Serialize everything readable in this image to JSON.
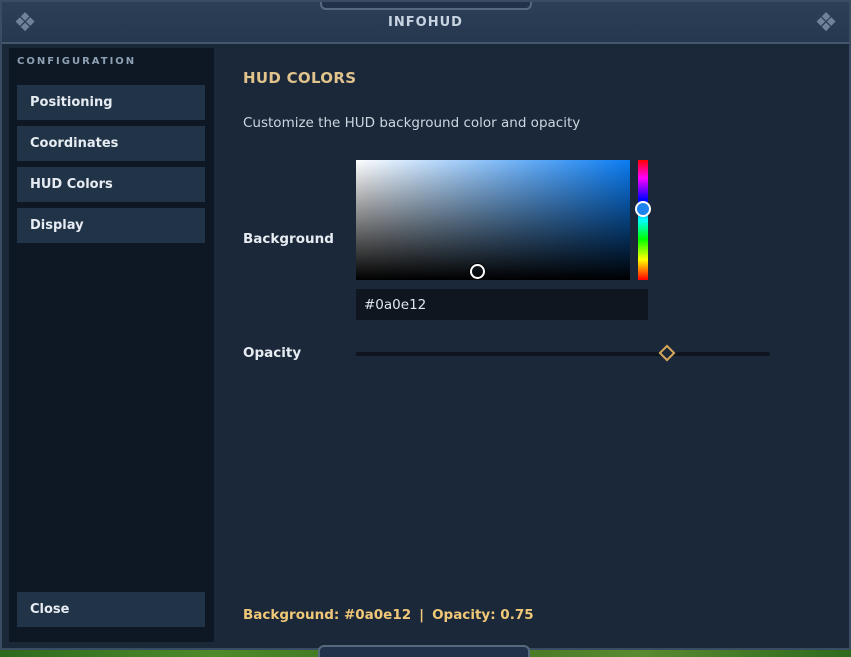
{
  "window": {
    "title": "INFOHUD"
  },
  "sidebar": {
    "section_label": "CONFIGURATION",
    "items": [
      {
        "label": "Positioning"
      },
      {
        "label": "Coordinates"
      },
      {
        "label": "HUD Colors"
      },
      {
        "label": "Display"
      }
    ],
    "close_label": "Close"
  },
  "main": {
    "title": "HUD COLORS",
    "description": "Customize the HUD background color and opacity",
    "background": {
      "label": "Background",
      "hex_value": "#0a0e12",
      "picker_hue_color": "#1c82ee"
    },
    "opacity": {
      "label": "Opacity",
      "value": 0.75
    },
    "status": {
      "background_text": "Background: #0a0e12",
      "separator": "|",
      "opacity_text": "Opacity: 0.75"
    }
  },
  "colors": {
    "accent_gold": "#e0c48c",
    "status_gold": "#f0c878",
    "panel_bg": "#1b2839",
    "sidebar_bg": "#0e1824",
    "nav_item_bg": "#213347"
  }
}
